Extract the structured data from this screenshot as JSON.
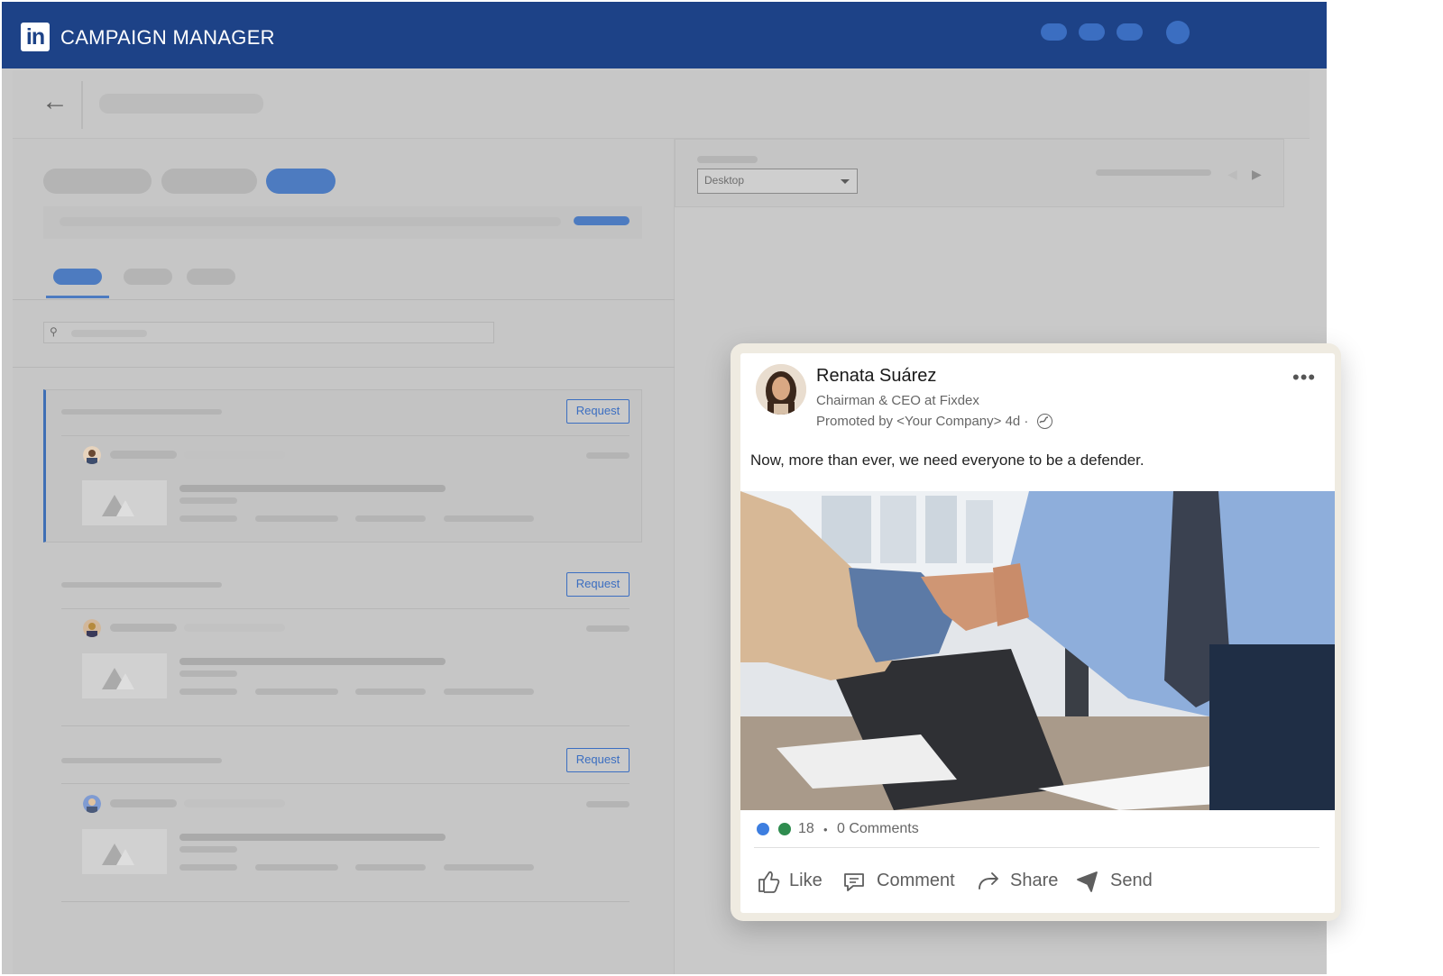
{
  "header": {
    "logo": "in",
    "title": "CAMPAIGN MANAGER"
  },
  "subbar": {
    "back_icon": "arrow-left-icon"
  },
  "preview": {
    "device_select": "Desktop"
  },
  "list": {
    "request_label": "Request"
  },
  "post": {
    "author": "Renata Suárez",
    "headline": "Chairman & CEO at Fixdex",
    "promoted": "Promoted by <Your Company> 4d ·",
    "more_label": "•••",
    "body": "Now, more than ever, we need everyone to be a defender.",
    "reactions_count": "18",
    "dot": "•",
    "comments": "0 Comments",
    "actions": {
      "like": "Like",
      "comment": "Comment",
      "share": "Share",
      "send": "Send"
    }
  },
  "colors": {
    "brand": "#1d4287",
    "accent": "#3b6ec1"
  }
}
